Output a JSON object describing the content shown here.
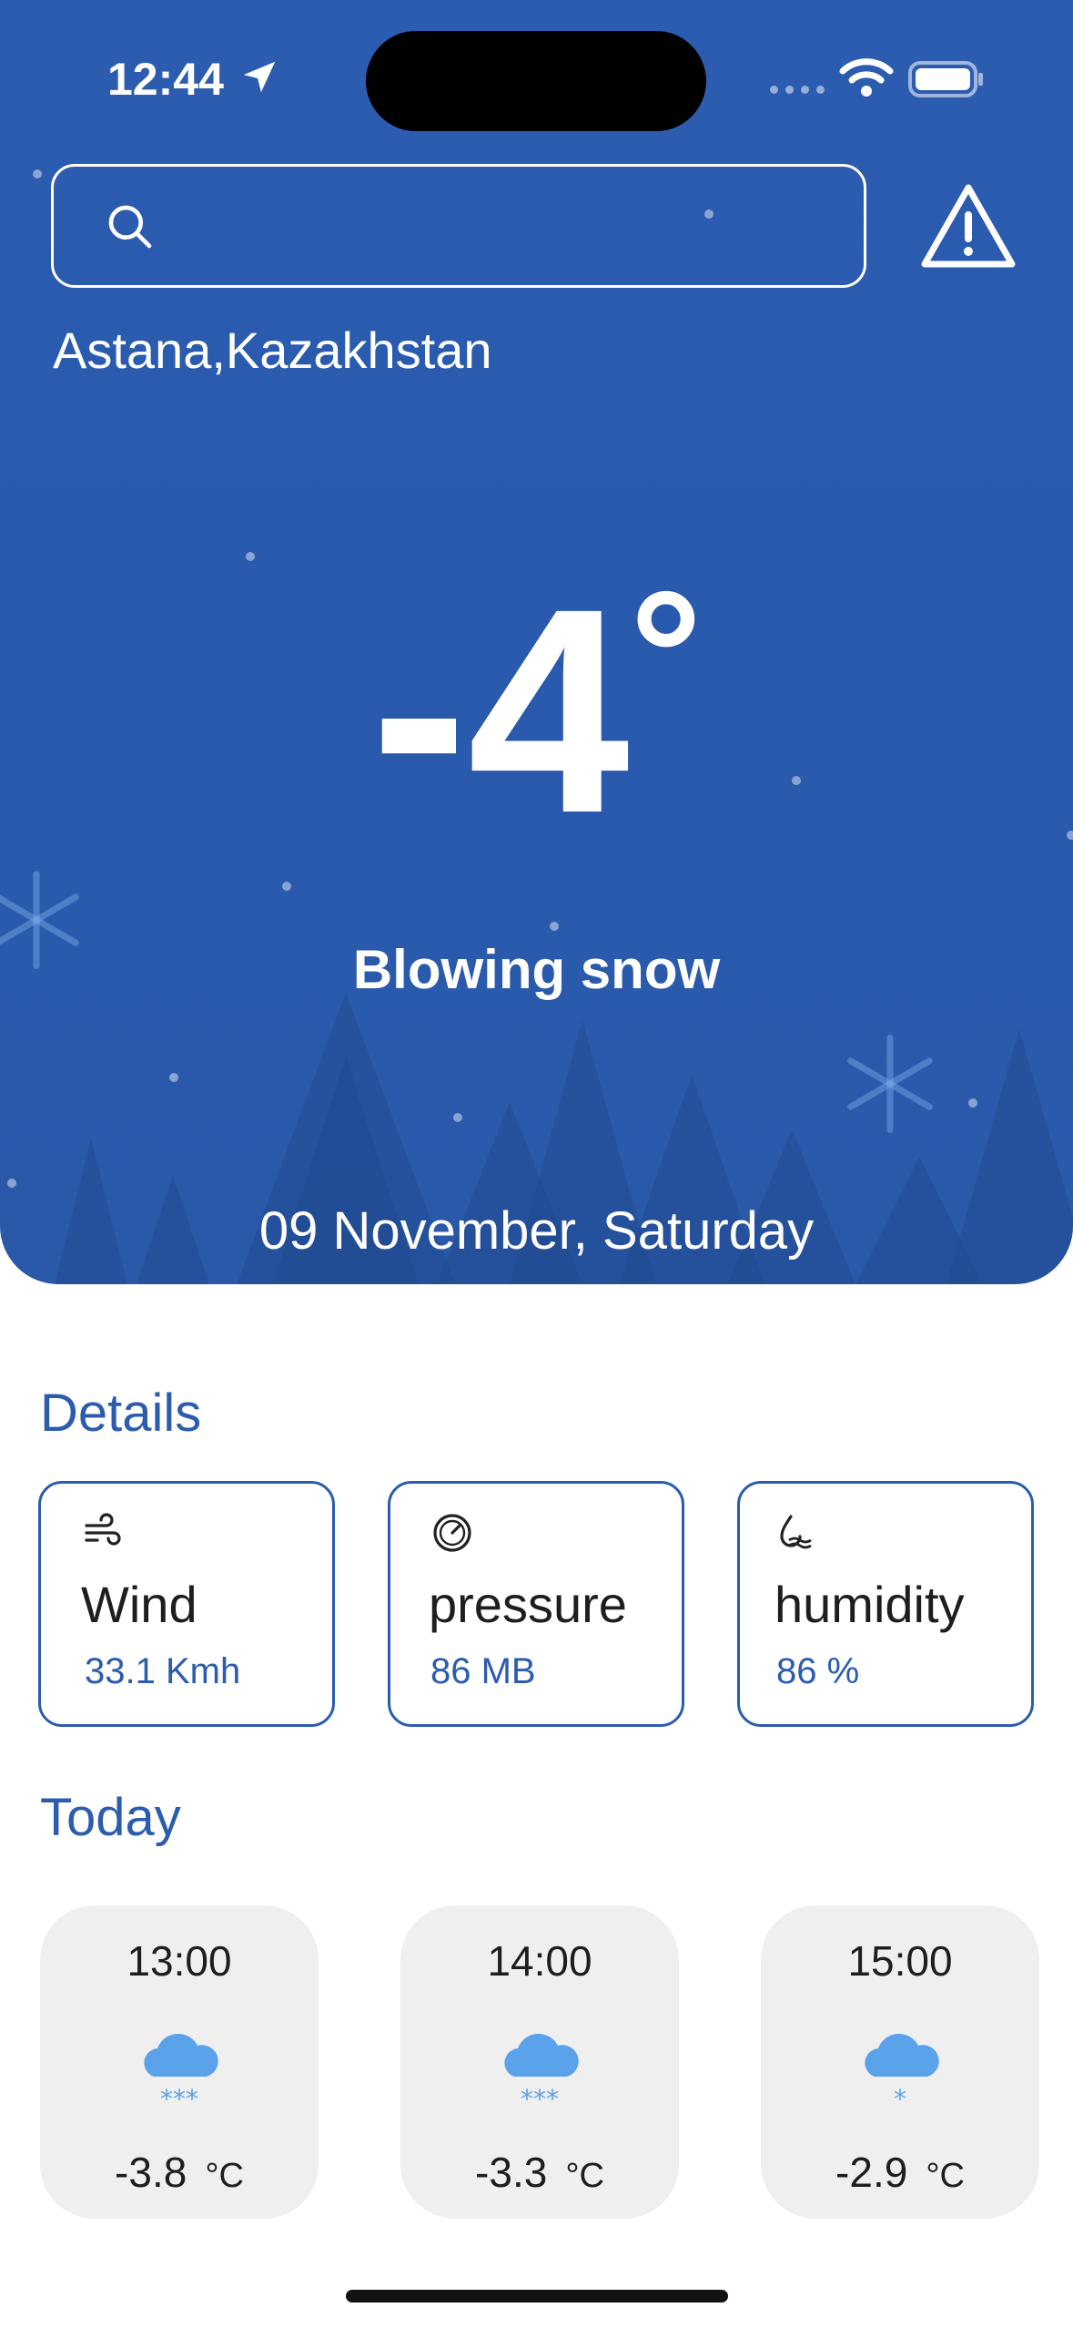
{
  "status_bar": {
    "time": "12:44"
  },
  "search": {
    "value": "",
    "placeholder": ""
  },
  "location": "Astana,Kazakhstan",
  "current": {
    "temperature": "-4",
    "degree_symbol": "°",
    "condition": "Blowing snow",
    "date": "09 November, Saturday"
  },
  "details": {
    "title": "Details",
    "items": [
      {
        "label": "Wind",
        "value": "33.1 Kmh",
        "icon": "wind-icon"
      },
      {
        "label": "pressure",
        "value": "86 MB",
        "icon": "gauge-icon"
      },
      {
        "label": "humidity",
        "value": "86 %",
        "icon": "humidity-icon"
      }
    ]
  },
  "today": {
    "title": "Today",
    "hours": [
      {
        "time": "13:00",
        "temp": "-3.8",
        "unit": "°C",
        "icon": "heavy-snow-icon"
      },
      {
        "time": "14:00",
        "temp": "-3.3",
        "unit": "°C",
        "icon": "heavy-snow-icon"
      },
      {
        "time": "15:00",
        "temp": "-2.9",
        "unit": "°C",
        "icon": "light-snow-icon"
      }
    ]
  },
  "colors": {
    "hero_blue": "#2c5cb0",
    "accent": "#2b5cad",
    "card_bg": "#efefef",
    "snow_icon": "#5aa2ea"
  }
}
